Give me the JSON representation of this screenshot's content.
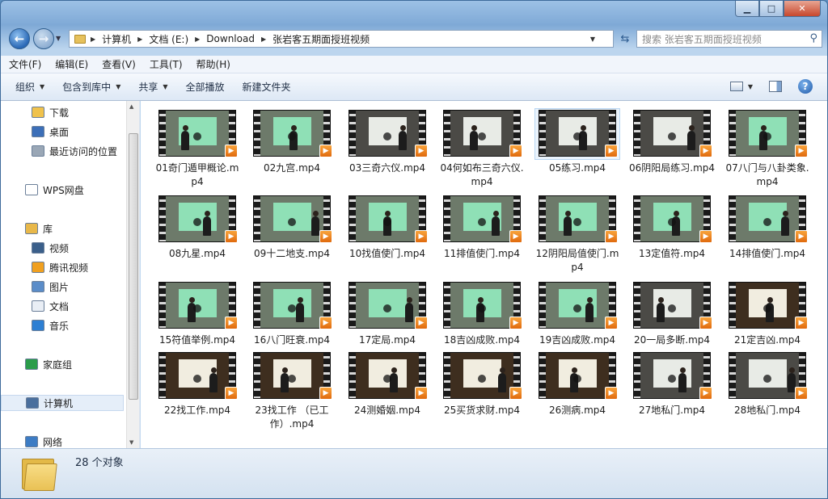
{
  "window": {
    "caption_minimize": "▁",
    "caption_maximize": "□",
    "caption_close": "✕"
  },
  "address": {
    "segments": [
      "计算机",
      "文档 (E:)",
      "Download",
      "张岩客五期面授班视频"
    ],
    "search_placeholder": "搜索 张岩客五期面授班视频"
  },
  "menu": [
    "文件(F)",
    "编辑(E)",
    "查看(V)",
    "工具(T)",
    "帮助(H)"
  ],
  "commands": [
    {
      "label": "组织",
      "dropdown": true
    },
    {
      "label": "包含到库中",
      "dropdown": true
    },
    {
      "label": "共享",
      "dropdown": true
    },
    {
      "label": "全部播放",
      "dropdown": false
    },
    {
      "label": "新建文件夹",
      "dropdown": false
    }
  ],
  "sidebar": {
    "items": [
      {
        "label": "下载",
        "icon": "download-folder-icon",
        "color": "#f0c24c"
      },
      {
        "label": "桌面",
        "icon": "desktop-icon",
        "color": "#3c6fb8"
      },
      {
        "label": "最近访问的位置",
        "icon": "recent-places-icon",
        "color": "#9aa7b6"
      },
      {
        "label": "WPS网盘",
        "icon": "cloud-icon",
        "color": "#ffffff"
      },
      {
        "label": "库",
        "icon": "library-icon",
        "color": "#e8b84a"
      },
      {
        "label": "视频",
        "icon": "video-library-icon",
        "color": "#3b5f8a"
      },
      {
        "label": "腾讯视频",
        "icon": "tencent-video-icon",
        "color": "#f0a020"
      },
      {
        "label": "图片",
        "icon": "pictures-icon",
        "color": "#5b8dc9"
      },
      {
        "label": "文档",
        "icon": "documents-icon",
        "color": "#e9eef5"
      },
      {
        "label": "音乐",
        "icon": "music-icon",
        "color": "#2d7fd3"
      },
      {
        "label": "家庭组",
        "icon": "homegroup-icon",
        "color": "#2a9c4a"
      },
      {
        "label": "计算机",
        "icon": "computer-icon",
        "color": "#4a6f9d"
      },
      {
        "label": "网络",
        "icon": "network-icon",
        "color": "#3d7cc4"
      }
    ]
  },
  "files": [
    {
      "name": "01奇门遁甲概论.mp4",
      "scene": "green"
    },
    {
      "name": "02九宫.mp4",
      "scene": "green"
    },
    {
      "name": "03三奇六仪.mp4",
      "scene": "white"
    },
    {
      "name": "04何如布三奇六仪.mp4",
      "scene": "white"
    },
    {
      "name": "05练习.mp4",
      "scene": "white"
    },
    {
      "name": "06阴阳局练习.mp4",
      "scene": "white"
    },
    {
      "name": "07八门与八卦类象.mp4",
      "scene": "green"
    },
    {
      "name": "08九星.mp4",
      "scene": "green"
    },
    {
      "name": "09十二地支.mp4",
      "scene": "green"
    },
    {
      "name": "10找值使门.mp4",
      "scene": "green"
    },
    {
      "name": "11排值使门.mp4",
      "scene": "green"
    },
    {
      "name": "12阴阳局值使门.mp4",
      "scene": "green"
    },
    {
      "name": "13定值符.mp4",
      "scene": "green"
    },
    {
      "name": "14排值使门.mp4",
      "scene": "green"
    },
    {
      "name": "15符值举例.mp4",
      "scene": "green"
    },
    {
      "name": "16八门旺衰.mp4",
      "scene": "green"
    },
    {
      "name": "17定局.mp4",
      "scene": "green"
    },
    {
      "name": "18吉凶成败.mp4",
      "scene": "green"
    },
    {
      "name": "19吉凶成败.mp4",
      "scene": "green"
    },
    {
      "name": "20一局多断.mp4",
      "scene": "white"
    },
    {
      "name": "21定吉凶.mp4",
      "scene": "warm"
    },
    {
      "name": "22找工作.mp4",
      "scene": "warm"
    },
    {
      "name": "23找工作 （已工作）.mp4",
      "scene": "warm"
    },
    {
      "name": "24测婚姻.mp4",
      "scene": "warm"
    },
    {
      "name": "25买货求财.mp4",
      "scene": "warm"
    },
    {
      "name": "26测病.mp4",
      "scene": "warm"
    },
    {
      "name": "27地私门.mp4",
      "scene": "white"
    },
    {
      "name": "28地私门.mp4",
      "scene": "white"
    }
  ],
  "selected_index": 4,
  "status": {
    "count_text": "28 个对象"
  }
}
